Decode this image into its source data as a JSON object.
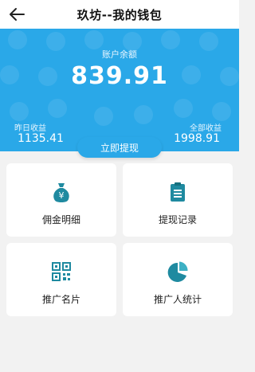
{
  "header": {
    "title": "玖坊--我的钱包",
    "back_icon": "back-arrow-icon"
  },
  "wallet": {
    "balance_label": "账户余额",
    "balance": "839.91",
    "yesterday_label": "昨日收益",
    "yesterday_value": "1135.41",
    "total_label": "全部收益",
    "total_value": "1998.91",
    "withdraw_label": "立即提现"
  },
  "menu": [
    {
      "label": "佣金明细",
      "icon": "money-bag-icon"
    },
    {
      "label": "提现记录",
      "icon": "clipboard-icon"
    },
    {
      "label": "推广名片",
      "icon": "qr-code-icon"
    },
    {
      "label": "推广人统计",
      "icon": "pie-chart-icon"
    }
  ],
  "colors": {
    "brand": "#2aa8e8",
    "icon": "#1f8aa0",
    "background": "#f2f2f2"
  }
}
